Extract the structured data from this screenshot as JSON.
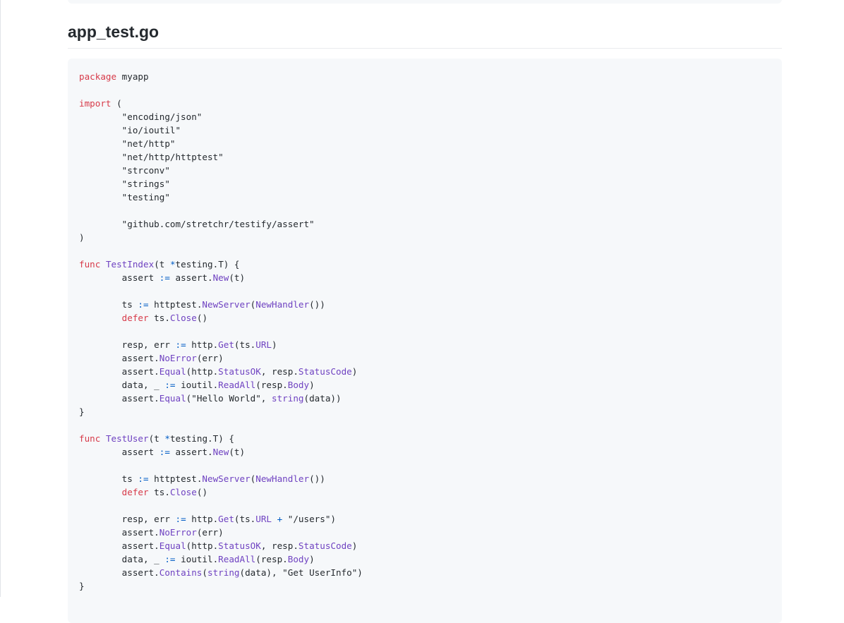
{
  "document": {
    "heading": "app_test.go"
  },
  "code": {
    "language": "go",
    "lines": [
      [
        [
          "kw",
          "package"
        ],
        [
          "p",
          " myapp"
        ]
      ],
      [],
      [
        [
          "kw",
          "import"
        ],
        [
          "p",
          " ("
        ]
      ],
      [
        [
          "p",
          "        \"encoding/json\""
        ]
      ],
      [
        [
          "p",
          "        \"io/ioutil\""
        ]
      ],
      [
        [
          "p",
          "        \"net/http\""
        ]
      ],
      [
        [
          "p",
          "        \"net/http/httptest\""
        ]
      ],
      [
        [
          "p",
          "        \"strconv\""
        ]
      ],
      [
        [
          "p",
          "        \"strings\""
        ]
      ],
      [
        [
          "p",
          "        \"testing\""
        ]
      ],
      [],
      [
        [
          "p",
          "        \"github.com/stretchr/testify/assert\""
        ]
      ],
      [
        [
          "p",
          ")"
        ]
      ],
      [],
      [
        [
          "kw",
          "func"
        ],
        [
          "p",
          " "
        ],
        [
          "fn",
          "TestIndex"
        ],
        [
          "p",
          "(t "
        ],
        [
          "op",
          "*"
        ],
        [
          "p",
          "testing.T) {"
        ]
      ],
      [
        [
          "p",
          "        assert "
        ],
        [
          "op",
          ":="
        ],
        [
          "p",
          " assert."
        ],
        [
          "fn",
          "New"
        ],
        [
          "p",
          "(t)"
        ]
      ],
      [],
      [
        [
          "p",
          "        ts "
        ],
        [
          "op",
          ":="
        ],
        [
          "p",
          " httptest."
        ],
        [
          "fn",
          "NewServer"
        ],
        [
          "p",
          "("
        ],
        [
          "fn",
          "NewHandler"
        ],
        [
          "p",
          "())"
        ]
      ],
      [
        [
          "p",
          "        "
        ],
        [
          "kw",
          "defer"
        ],
        [
          "p",
          " ts."
        ],
        [
          "fn",
          "Close"
        ],
        [
          "p",
          "()"
        ]
      ],
      [],
      [
        [
          "p",
          "        resp, err "
        ],
        [
          "op",
          ":="
        ],
        [
          "p",
          " http."
        ],
        [
          "fn",
          "Get"
        ],
        [
          "p",
          "(ts."
        ],
        [
          "fn",
          "URL"
        ],
        [
          "p",
          ")"
        ]
      ],
      [
        [
          "p",
          "        assert."
        ],
        [
          "fn",
          "NoError"
        ],
        [
          "p",
          "(err)"
        ]
      ],
      [
        [
          "p",
          "        assert."
        ],
        [
          "fn",
          "Equal"
        ],
        [
          "p",
          "(http."
        ],
        [
          "fn",
          "StatusOK"
        ],
        [
          "p",
          ", resp."
        ],
        [
          "fn",
          "StatusCode"
        ],
        [
          "p",
          ")"
        ]
      ],
      [
        [
          "p",
          "        data, _ "
        ],
        [
          "op",
          ":="
        ],
        [
          "p",
          " ioutil."
        ],
        [
          "fn",
          "ReadAll"
        ],
        [
          "p",
          "(resp."
        ],
        [
          "fn",
          "Body"
        ],
        [
          "p",
          ")"
        ]
      ],
      [
        [
          "p",
          "        assert."
        ],
        [
          "fn",
          "Equal"
        ],
        [
          "p",
          "(\"Hello World\", "
        ],
        [
          "fn",
          "string"
        ],
        [
          "p",
          "(data))"
        ]
      ],
      [
        [
          "p",
          "}"
        ]
      ],
      [],
      [
        [
          "kw",
          "func"
        ],
        [
          "p",
          " "
        ],
        [
          "fn",
          "TestUser"
        ],
        [
          "p",
          "(t "
        ],
        [
          "op",
          "*"
        ],
        [
          "p",
          "testing.T) {"
        ]
      ],
      [
        [
          "p",
          "        assert "
        ],
        [
          "op",
          ":="
        ],
        [
          "p",
          " assert."
        ],
        [
          "fn",
          "New"
        ],
        [
          "p",
          "(t)"
        ]
      ],
      [],
      [
        [
          "p",
          "        ts "
        ],
        [
          "op",
          ":="
        ],
        [
          "p",
          " httptest."
        ],
        [
          "fn",
          "NewServer"
        ],
        [
          "p",
          "("
        ],
        [
          "fn",
          "NewHandler"
        ],
        [
          "p",
          "())"
        ]
      ],
      [
        [
          "p",
          "        "
        ],
        [
          "kw",
          "defer"
        ],
        [
          "p",
          " ts."
        ],
        [
          "fn",
          "Close"
        ],
        [
          "p",
          "()"
        ]
      ],
      [],
      [
        [
          "p",
          "        resp, err "
        ],
        [
          "op",
          ":="
        ],
        [
          "p",
          " http."
        ],
        [
          "fn",
          "Get"
        ],
        [
          "p",
          "(ts."
        ],
        [
          "fn",
          "URL"
        ],
        [
          "p",
          " "
        ],
        [
          "op",
          "+"
        ],
        [
          "p",
          " \"/users\")"
        ]
      ],
      [
        [
          "p",
          "        assert."
        ],
        [
          "fn",
          "NoError"
        ],
        [
          "p",
          "(err)"
        ]
      ],
      [
        [
          "p",
          "        assert."
        ],
        [
          "fn",
          "Equal"
        ],
        [
          "p",
          "(http."
        ],
        [
          "fn",
          "StatusOK"
        ],
        [
          "p",
          ", resp."
        ],
        [
          "fn",
          "StatusCode"
        ],
        [
          "p",
          ")"
        ]
      ],
      [
        [
          "p",
          "        data, _ "
        ],
        [
          "op",
          ":="
        ],
        [
          "p",
          " ioutil."
        ],
        [
          "fn",
          "ReadAll"
        ],
        [
          "p",
          "(resp."
        ],
        [
          "fn",
          "Body"
        ],
        [
          "p",
          ")"
        ]
      ],
      [
        [
          "p",
          "        assert."
        ],
        [
          "fn",
          "Contains"
        ],
        [
          "p",
          "("
        ],
        [
          "fn",
          "string"
        ],
        [
          "p",
          "(data), \"Get UserInfo\")"
        ]
      ],
      [
        [
          "p",
          "}"
        ]
      ]
    ]
  },
  "colors": {
    "keyword": "#d73a49",
    "function": "#6f42c1",
    "operator": "#005cc5",
    "text": "#24292e",
    "code_background": "#f6f8fa"
  }
}
